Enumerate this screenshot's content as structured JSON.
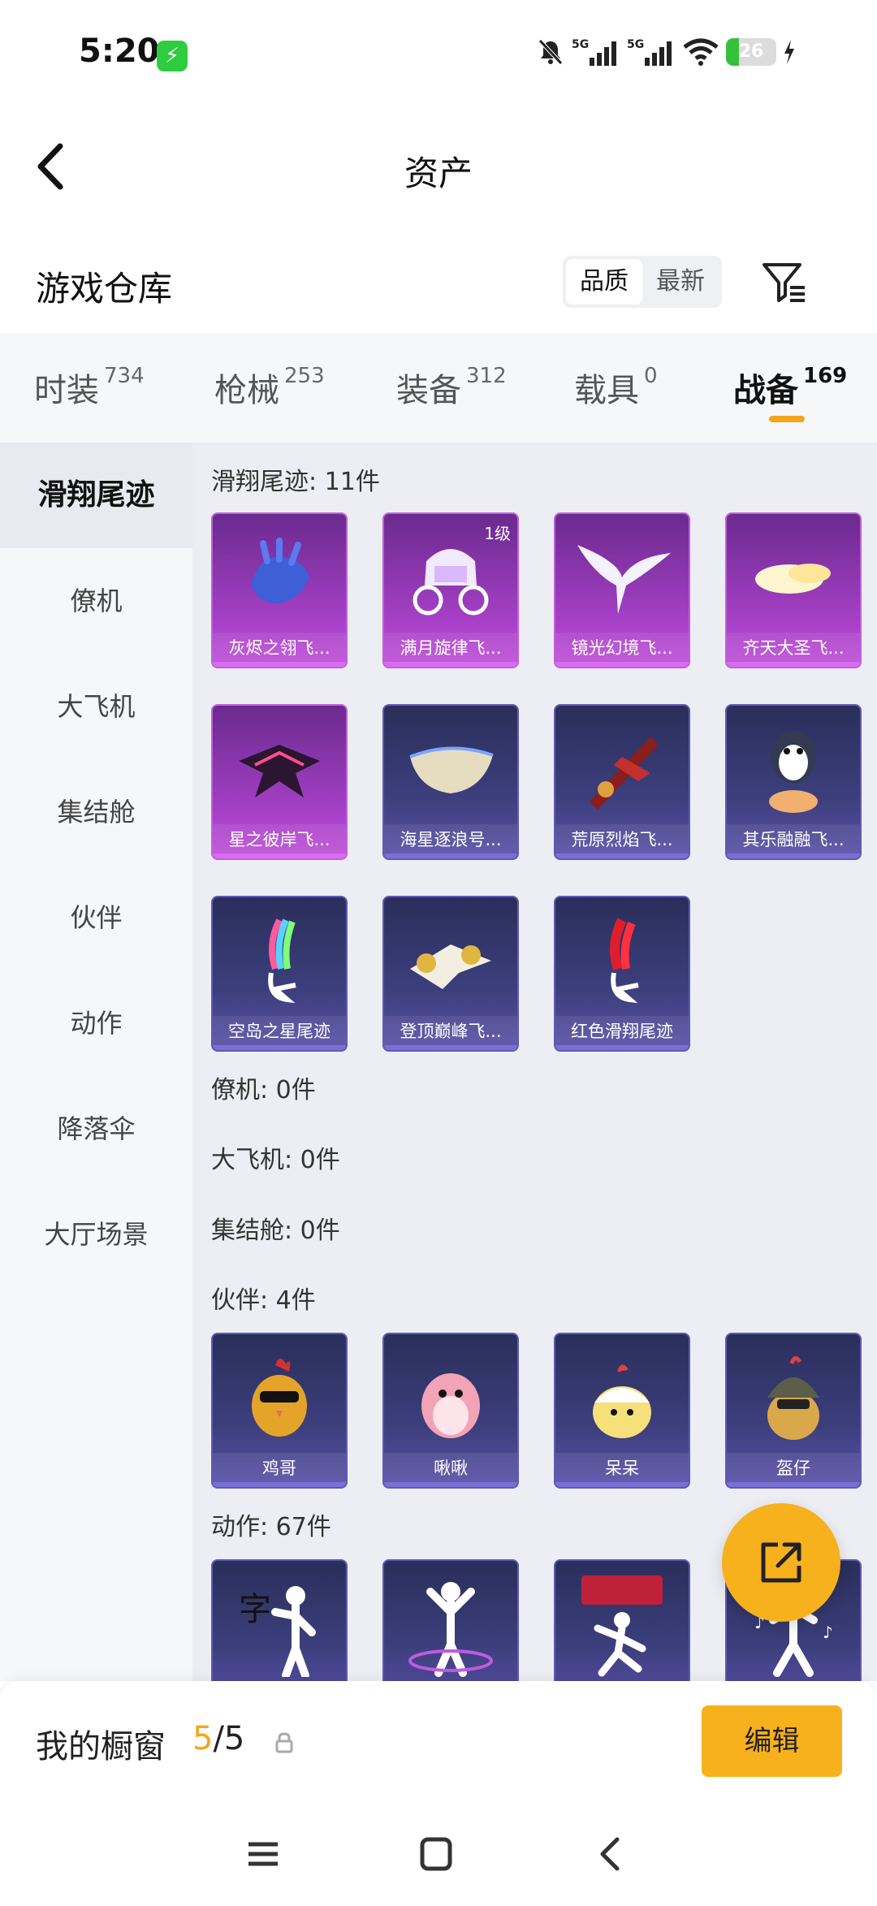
{
  "status_bar": {
    "time": "5:20",
    "charging_badge": "⚡",
    "battery_level": "26",
    "battery_fraction": 0.26,
    "network": "5G"
  },
  "header": {
    "title": "资产"
  },
  "section": {
    "title": "游戏仓库",
    "sort_options": [
      "品质",
      "最新"
    ],
    "sort_active": "品质"
  },
  "tabs": [
    {
      "label": "时装",
      "count": "734"
    },
    {
      "label": "枪械",
      "count": "253"
    },
    {
      "label": "装备",
      "count": "312"
    },
    {
      "label": "载具",
      "count": "0"
    },
    {
      "label": "战备",
      "count": "169"
    }
  ],
  "sidebar": [
    "滑翔尾迹",
    "僚机",
    "大飞机",
    "集结舱",
    "伙伴",
    "动作",
    "降落伞",
    "大厅场景"
  ],
  "groups": {
    "glide": {
      "title": "滑翔尾迹: 11件",
      "items": [
        {
          "name": "灰烬之翎飞...",
          "rarity": "purple",
          "icon": "glove-icon"
        },
        {
          "name": "满月旋律飞...",
          "rarity": "purple",
          "icon": "carriage-icon",
          "level": "1级"
        },
        {
          "name": "镜光幻境飞...",
          "rarity": "purple",
          "icon": "wing-icon"
        },
        {
          "name": "齐天大圣飞...",
          "rarity": "purple",
          "icon": "cloud-icon"
        },
        {
          "name": "星之彼岸飞...",
          "rarity": "purple",
          "icon": "dark-wing-icon"
        },
        {
          "name": "海星逐浪号...",
          "rarity": "blue",
          "icon": "boat-icon"
        },
        {
          "name": "荒原烈焰飞...",
          "rarity": "blue",
          "icon": "flame-craft-icon"
        },
        {
          "name": "其乐融融飞...",
          "rarity": "blue",
          "icon": "penguin-icon"
        },
        {
          "name": "空岛之星尾迹",
          "rarity": "blue",
          "icon": "rainbow-trail-icon"
        },
        {
          "name": "登顶巅峰飞...",
          "rarity": "blue",
          "icon": "jet-icon"
        },
        {
          "name": "红色滑翔尾迹",
          "rarity": "blue",
          "icon": "red-trail-icon"
        }
      ]
    },
    "wingman": {
      "title": "僚机: 0件"
    },
    "plane": {
      "title": "大飞机: 0件"
    },
    "pod": {
      "title": "集结舱: 0件"
    },
    "partner": {
      "title": "伙伴: 4件",
      "items": [
        {
          "name": "鸡哥",
          "rarity": "blue",
          "icon": "chicken-sunglasses-icon"
        },
        {
          "name": "啾啾",
          "rarity": "blue",
          "icon": "pink-bird-icon"
        },
        {
          "name": "呆呆",
          "rarity": "blue",
          "icon": "chick-icon"
        },
        {
          "name": "盔仔",
          "rarity": "blue",
          "icon": "helmet-chick-icon"
        }
      ]
    },
    "emote": {
      "title": "动作: 67件",
      "items": [
        {
          "name": "",
          "rarity": "blue",
          "icon": "emote-calligraphy-icon"
        },
        {
          "name": "",
          "rarity": "blue",
          "icon": "emote-dance-icon"
        },
        {
          "name": "",
          "rarity": "blue",
          "icon": "emote-poster-icon"
        },
        {
          "name": "",
          "rarity": "blue",
          "icon": "emote-music-icon"
        }
      ]
    }
  },
  "showcase": {
    "label": "我的橱窗",
    "current": "5",
    "total": "/5",
    "edit_label": "编辑"
  },
  "colors": {
    "accent": "#f7b11c",
    "purple_card": "#a640c6",
    "blue_card": "#3c3f7c"
  }
}
